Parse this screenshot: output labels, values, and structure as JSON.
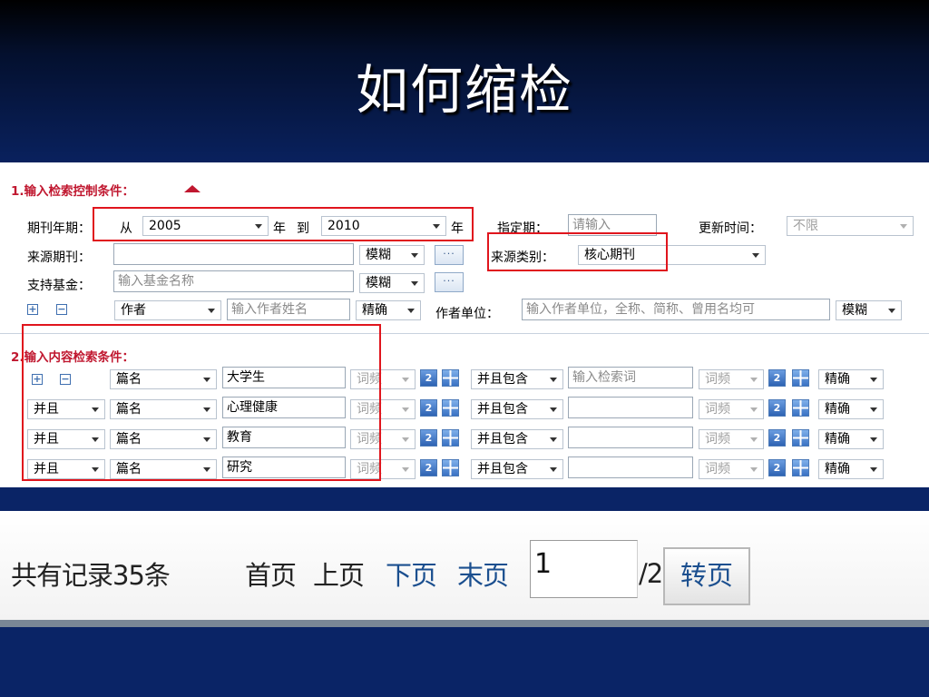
{
  "slide": {
    "title": "如何缩检"
  },
  "section1": {
    "heading": "1.输入检索控制条件：",
    "year_label": "期刊年期：",
    "from_label": "从",
    "from_year": "2005",
    "year_unit_1": "年",
    "to_label": "到",
    "to_year": "2010",
    "year_unit_2": "年",
    "issue_label": "指定期：",
    "issue_placeholder": "请输入",
    "update_label": "更新时间：",
    "update_value": "不限",
    "source_journal_label": "来源期刊：",
    "source_journal_value": "",
    "fuzzy_1": "模糊",
    "source_type_label": "来源类别：",
    "source_type_value": "核心期刊",
    "fund_label": "支持基金：",
    "fund_placeholder": "输入基金名称",
    "fuzzy_2": "模糊",
    "author_field": "作者",
    "author_placeholder": "输入作者姓名",
    "exact_1": "精确",
    "author_unit_label": "作者单位：",
    "author_unit_placeholder": "输入作者单位，全称、简称、曾用名均可",
    "fuzzy_3": "模糊",
    "more_button": "···",
    "plus": "+",
    "minus": "−"
  },
  "section2": {
    "heading": "2.输入内容检索条件：",
    "rows": [
      {
        "logic": "",
        "field": "篇名",
        "term": "大学生",
        "freq": "词频",
        "combine": "并且包含",
        "term2": "",
        "term2_placeholder": "输入检索词",
        "freq2": "词频",
        "match": "精确"
      },
      {
        "logic": "并且",
        "field": "篇名",
        "term": "心理健康",
        "freq": "词频",
        "combine": "并且包含",
        "term2": "",
        "term2_placeholder": "",
        "freq2": "词频",
        "match": "精确"
      },
      {
        "logic": "并且",
        "field": "篇名",
        "term": "教育",
        "freq": "词频",
        "combine": "并且包含",
        "term2": "",
        "term2_placeholder": "",
        "freq2": "词频",
        "match": "精确"
      },
      {
        "logic": "并且",
        "field": "篇名",
        "term": "研究",
        "freq": "词频",
        "combine": "并且包含",
        "term2": "",
        "term2_placeholder": "",
        "freq2": "词频",
        "match": "精确"
      }
    ]
  },
  "pager": {
    "total": "共有记录35条",
    "first": "首页",
    "prev": "上页",
    "next": "下页",
    "last": "末页",
    "page_value": "1",
    "page_total": "/2",
    "go_button": "转页"
  },
  "colors": {
    "highlight_box": "#e0151d",
    "slide_bg": "#0a2466",
    "heading_red": "#c0172f"
  }
}
